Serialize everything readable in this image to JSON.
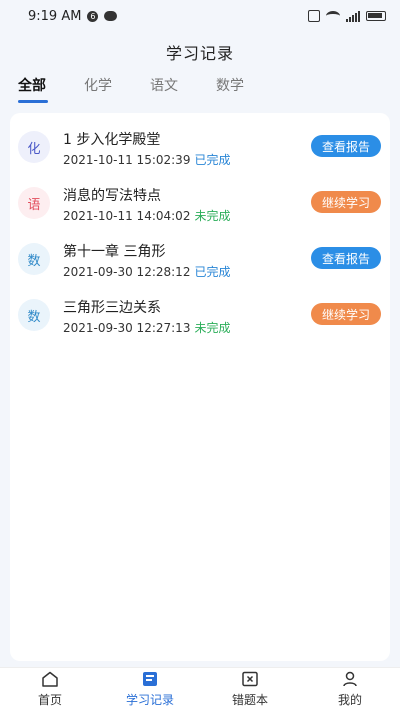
{
  "status_bar": {
    "time": "9:19 AM",
    "notif_badge": "6"
  },
  "header": {
    "title": "学习记录"
  },
  "tabs": [
    {
      "label": "全部",
      "active": true
    },
    {
      "label": "化学",
      "active": false
    },
    {
      "label": "语文",
      "active": false
    },
    {
      "label": "数学",
      "active": false
    }
  ],
  "records": [
    {
      "subject_char": "化",
      "title": "1 步入化学殿堂",
      "datetime": "2021-10-11 15:02:39",
      "status": "已完成",
      "action": "查看报告"
    },
    {
      "subject_char": "语",
      "title": "消息的写法特点",
      "datetime": "2021-10-11 14:04:02",
      "status": "未完成",
      "action": "继续学习"
    },
    {
      "subject_char": "数",
      "title": "第十一章 三角形",
      "datetime": "2021-09-30 12:28:12",
      "status": "已完成",
      "action": "查看报告"
    },
    {
      "subject_char": "数",
      "title": "三角形三边关系",
      "datetime": "2021-09-30 12:27:13",
      "status": "未完成",
      "action": "继续学习"
    }
  ],
  "bottom_nav": [
    {
      "label": "首页",
      "icon": "home-icon",
      "active": false
    },
    {
      "label": "学习记录",
      "icon": "book-icon",
      "active": true
    },
    {
      "label": "错题本",
      "icon": "error-book-icon",
      "active": false
    },
    {
      "label": "我的",
      "icon": "user-icon",
      "active": false
    }
  ],
  "colors": {
    "accent": "#2a6fd6",
    "button_blue": "#2b8ee6",
    "button_orange": "#f08a4b",
    "done": "#2a86d6",
    "undone": "#2cae5a"
  }
}
